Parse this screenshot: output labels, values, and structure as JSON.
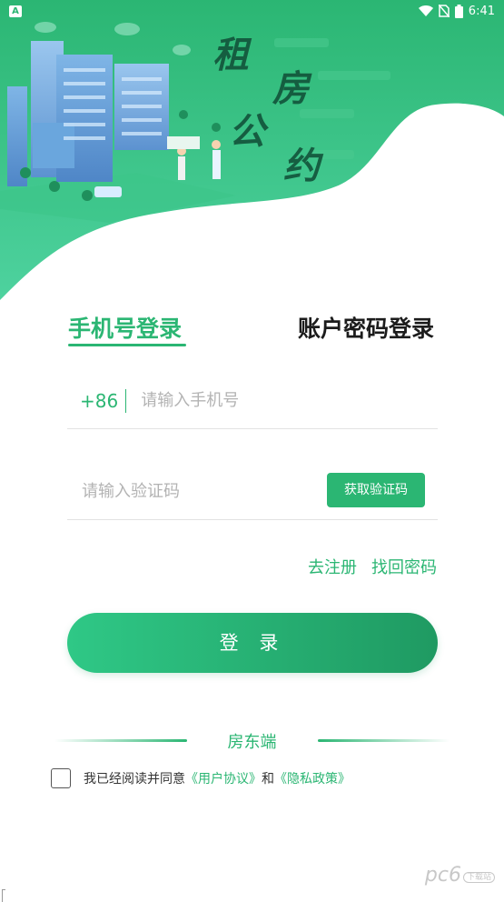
{
  "status_bar": {
    "time": "6:41",
    "app_badge": "A",
    "wifi_icon": "wifi-icon",
    "signal_icon": "no-sim-icon",
    "battery_icon": "battery-icon"
  },
  "hero": {
    "title_chars": [
      "租",
      "房",
      "公",
      "约"
    ],
    "colors": {
      "top": "#2bb673",
      "bottom": "#4fd3a0"
    }
  },
  "tabs": {
    "phone_login": "手机号登录",
    "password_login": "账户密码登录"
  },
  "form": {
    "country_code": "+86",
    "phone_placeholder": "请输入手机号",
    "code_placeholder": "请输入验证码",
    "get_code_label": "获取验证码"
  },
  "links": {
    "register": "去注册",
    "forgot": "找回密码"
  },
  "login_button": "登 录",
  "role_switch": "房东端",
  "agreement": {
    "prefix": "我已经阅读并同意",
    "user_agreement": "《用户协议》",
    "conj": "和",
    "privacy": "《隐私政策》"
  },
  "watermark": {
    "text": "pc6",
    "sub": "下载站"
  },
  "colors": {
    "accent": "#2bb673",
    "button_start": "#2fc886",
    "button_end": "#1f9a62"
  }
}
